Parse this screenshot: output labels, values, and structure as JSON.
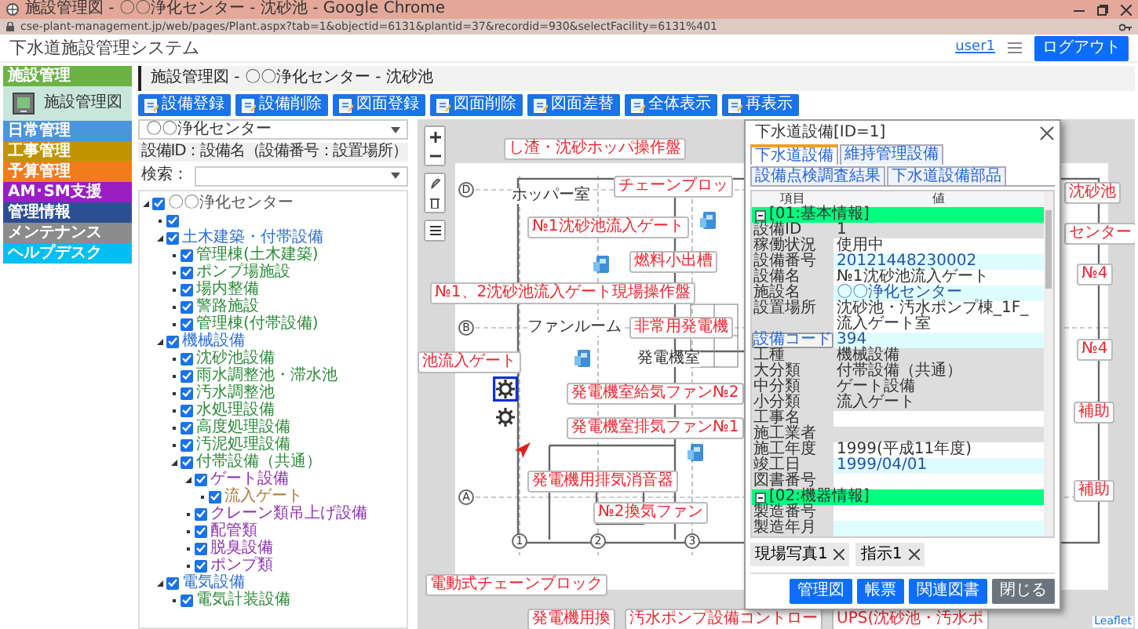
{
  "browser": {
    "title": "施設管理図 - 〇〇浄化センター - 沈砂池 - Google Chrome",
    "url": "cse-plant-management.jp/web/pages/Plant.aspx?tab=1&objectid=6131&plantid=37&recordid=930&selectFacility=6131%401"
  },
  "app": {
    "title": "下水道施設管理システム",
    "user": "user1",
    "logout": "ログアウト"
  },
  "sidebar": {
    "items": [
      {
        "kind": "category",
        "label": "施設管理",
        "color": "#6ab344"
      },
      {
        "kind": "sub",
        "label": "施設管理図"
      },
      {
        "kind": "category",
        "label": "日常管理",
        "color": "#4a95dc"
      },
      {
        "kind": "category",
        "label": "工事管理",
        "color": "#c29400"
      },
      {
        "kind": "category",
        "label": "予算管理",
        "color": "#f27b1c"
      },
      {
        "kind": "category",
        "label": "AM･SM支援",
        "color": "#9a1dc4"
      },
      {
        "kind": "category",
        "label": "管理情報",
        "color": "#2c4f93"
      },
      {
        "kind": "category",
        "label": "メンテナンス",
        "color": "#8c8c8c"
      },
      {
        "kind": "category",
        "label": "ヘルプデスク",
        "color": "#00bff3"
      }
    ]
  },
  "page_header": "施設管理図 - 〇〇浄化センター - 沈砂池",
  "toolbar": [
    "設備登録",
    "設備削除",
    "図面登録",
    "図面削除",
    "図面差替",
    "全体表示",
    "再表示"
  ],
  "left_panel": {
    "facility": "〇〇浄化センター",
    "legend": "設備ID：設備名（設備番号：設置場所）",
    "search_label": "検索：",
    "tree": [
      {
        "label": "〇〇浄化センター",
        "checked": true,
        "children": [
          {
            "checked": true
          },
          {
            "label": "土木建築・付帯設備",
            "checked": true,
            "children": [
              {
                "label": "管理棟(土木建築)",
                "checked": true
              },
              {
                "label": "ポンプ場施設",
                "checked": true
              },
              {
                "label": "場内整備",
                "checked": true
              },
              {
                "label": "警路施設",
                "checked": true
              },
              {
                "label": "管理棟(付帯設備)",
                "checked": true
              }
            ]
          },
          {
            "label": "機械設備",
            "checked": true,
            "children": [
              {
                "label": "沈砂池設備",
                "checked": true
              },
              {
                "label": "雨水調整池・滞水池",
                "checked": true
              },
              {
                "label": "汚水調整池",
                "checked": true
              },
              {
                "label": "水処理設備",
                "checked": true
              },
              {
                "label": "高度処理設備",
                "checked": true
              },
              {
                "label": "汚泥処理設備",
                "checked": true
              },
              {
                "label": "付帯設備（共通）",
                "checked": true,
                "children": [
                  {
                    "label": "ゲート設備",
                    "checked": true,
                    "children": [
                      {
                        "label": "流入ゲート",
                        "checked": true
                      }
                    ]
                  },
                  {
                    "label": "クレーン類吊上げ設備",
                    "checked": true
                  },
                  {
                    "label": "配管類",
                    "checked": true
                  },
                  {
                    "label": "脱臭設備",
                    "checked": true
                  },
                  {
                    "label": "ポンプ類",
                    "checked": true
                  }
                ]
              }
            ]
          },
          {
            "label": "電気設備",
            "checked": true,
            "children": [
              {
                "label": "電気計装設備",
                "checked": true
              }
            ]
          }
        ]
      }
    ]
  },
  "map": {
    "labels": [
      "し渣・沈砂ホッパ操作盤",
      "チェーンブロッ",
      "沈砂池",
      "№1沈砂池流入ゲート",
      "センター",
      "燃料小出槽",
      "№4",
      "№1、2沈砂池流入ゲート現場操作盤",
      "非常用発電機",
      "№4",
      "池流入ゲート",
      "発電機室給気ファン№2",
      "補助",
      "発電機室排気ファン№1",
      "発電機用排気消音器",
      "補助",
      "№2換気ファン",
      "電動式チェーンブロック",
      "発電機用換",
      "汚水ポンプ設備コントロー",
      "UPS(沈砂池・汚水ポ"
    ],
    "rooms": [
      "ホッパー室",
      "ファンルーム",
      "発電機室"
    ],
    "grid": [
      "D",
      "B",
      "A",
      "1",
      "2",
      "3"
    ],
    "attribution": "Leaflet"
  },
  "dialog": {
    "title": "下水道設備[ID=1]",
    "tabs": [
      {
        "label": "下水道設備",
        "selected": true
      },
      {
        "label": "維持管理設備",
        "selected": false
      },
      {
        "label": "設備点検調査結果",
        "selected": false
      },
      {
        "label": "下水道設備部品",
        "selected": false
      }
    ],
    "columns": [
      "項目",
      "値"
    ],
    "rows": [
      {
        "kind": "section",
        "label": "[01:基本情報]"
      },
      {
        "kind": "field",
        "label": "設備ID",
        "value": "1",
        "readonly": true,
        "tinted": false
      },
      {
        "kind": "field",
        "label": "稼働状況",
        "value": "使用中",
        "readonly": false,
        "tinted": false
      },
      {
        "kind": "field",
        "label": "設備番号",
        "value": "20121448230002",
        "readonly": false,
        "tinted": true
      },
      {
        "kind": "field",
        "label": "設備名",
        "value": "№1沈砂池流入ゲート",
        "readonly": false,
        "tinted": false
      },
      {
        "kind": "field",
        "label": "施設名",
        "value": "〇〇浄化センター",
        "readonly": false,
        "tinted": true
      },
      {
        "kind": "field",
        "label": "設置場所",
        "value": "沈砂池・汚水ポンプ棟_1F_流入ゲート室",
        "readonly": false,
        "tinted": false
      },
      {
        "kind": "button",
        "label": "設備コード",
        "value": "394",
        "readonly": false,
        "tinted": true
      },
      {
        "kind": "field",
        "label": "工種",
        "value": "機械設備",
        "readonly": true,
        "tinted": false
      },
      {
        "kind": "field",
        "label": "大分類",
        "value": "付帯設備（共通）",
        "readonly": true,
        "tinted": false
      },
      {
        "kind": "field",
        "label": "中分類",
        "value": "ゲート設備",
        "readonly": true,
        "tinted": false
      },
      {
        "kind": "field",
        "label": "小分類",
        "value": "流入ゲート",
        "readonly": true,
        "tinted": false
      },
      {
        "kind": "field",
        "label": "工事名",
        "readonly": false,
        "tinted": false
      },
      {
        "kind": "field",
        "label": "施工業者",
        "readonly": true,
        "tinted": false
      },
      {
        "kind": "field",
        "label": "施工年度",
        "value": "1999(平成11年度)",
        "readonly": false,
        "tinted": false
      },
      {
        "kind": "field",
        "label": "竣工日",
        "value": "1999/04/01",
        "readonly": false,
        "tinted": true
      },
      {
        "kind": "field",
        "label": "図書番号",
        "readonly": false,
        "tinted": false
      },
      {
        "kind": "section",
        "label": "[02:機器情報]"
      },
      {
        "kind": "field",
        "label": "製造番号",
        "readonly": false,
        "tinted": false
      },
      {
        "kind": "field",
        "label": "製造年月",
        "readonly": false,
        "tinted": true
      }
    ],
    "attachments": [
      "現場写真1",
      "指示1"
    ],
    "buttons": [
      {
        "label": "管理図",
        "kind": "primary"
      },
      {
        "label": "帳票",
        "kind": "primary"
      },
      {
        "label": "関連図書",
        "kind": "primary"
      },
      {
        "label": "閉じる",
        "kind": "secondary"
      }
    ]
  }
}
